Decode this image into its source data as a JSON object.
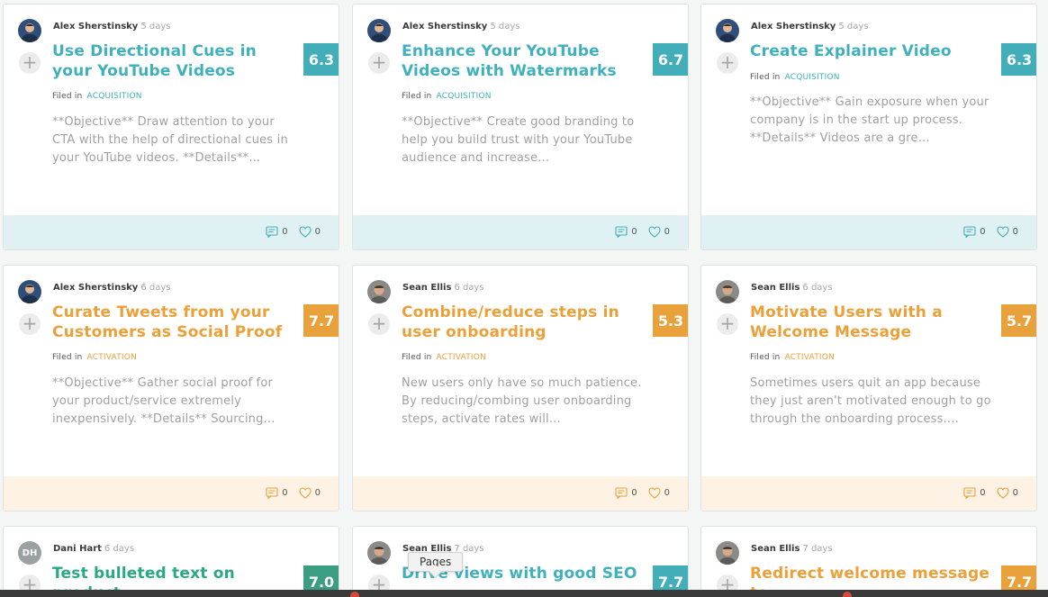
{
  "cards": [
    {
      "color": "teal",
      "avatar": "person-photo",
      "author": "Alex Sherstinsky",
      "time": "5 days",
      "title": "Use Directional Cues in your YouTube Videos",
      "score": "6.3",
      "filed_label": "Filed in",
      "category": "ACQUISITION",
      "description": "**Objective** Draw attention to your CTA with the help of directional cues in your YouTube videos. **Details**...",
      "comments": "0",
      "likes": "0"
    },
    {
      "color": "teal",
      "avatar": "person-photo",
      "author": "Alex Sherstinsky",
      "time": "5 days",
      "title": "Enhance Your YouTube Videos with Watermarks",
      "score": "6.7",
      "filed_label": "Filed in",
      "category": "ACQUISITION",
      "description": "**Objective** Create good branding to help you build trust with your YouTube audience and increase...",
      "comments": "0",
      "likes": "0"
    },
    {
      "color": "teal",
      "avatar": "person-photo",
      "author": "Alex Sherstinsky",
      "time": "5 days",
      "title": "Create Explainer Video",
      "score": "6.3",
      "filed_label": "Filed in",
      "category": "ACQUISITION",
      "description": "**Objective** Gain exposure when your company is in the start up process. **Details** Videos are a gre...",
      "comments": "0",
      "likes": "0"
    },
    {
      "color": "orange",
      "avatar": "person-photo",
      "author": "Alex Sherstinsky",
      "time": "6 days",
      "title": "Curate Tweets from your Customers as Social Proof",
      "score": "7.7",
      "filed_label": "Filed in",
      "category": "ACTIVATION",
      "description": "**Objective** Gather social proof for your product/service extremely inexpensively. **Details** Sourcing...",
      "comments": "0",
      "likes": "0"
    },
    {
      "color": "orange",
      "avatar": "person-photo",
      "author": "Sean Ellis",
      "time": "6 days",
      "title": "Combine/reduce steps in user onboarding",
      "score": "5.3",
      "filed_label": "Filed in",
      "category": "ACTIVATION",
      "description": "New users only have so much patience. By reducing/combing user onboarding steps, activate rates will...",
      "comments": "0",
      "likes": "0"
    },
    {
      "color": "orange",
      "avatar": "person-photo",
      "author": "Sean Ellis",
      "time": "6 days",
      "title": "Motivate Users with a Welcome Message",
      "score": "5.7",
      "filed_label": "Filed in",
      "category": "ACTIVATION",
      "description": "Sometimes users quit an app because they just aren't motivated enough to go through the onboarding process....",
      "comments": "0",
      "likes": "0"
    },
    {
      "color": "green",
      "avatar": "initials",
      "initials": "DH",
      "author": "Dani Hart",
      "time": "6 days",
      "title": "Test bulleted text on product",
      "score": "7.0"
    },
    {
      "color": "teal",
      "avatar": "person-photo",
      "author": "Sean Ellis",
      "time": "7 days",
      "title": "Drive views with good SEO",
      "score": "7.7"
    },
    {
      "color": "orange",
      "avatar": "person-photo",
      "author": "Sean Ellis",
      "time": "7 days",
      "title": "Redirect welcome message to",
      "score": "7.7"
    }
  ],
  "tooltip": "Pages"
}
